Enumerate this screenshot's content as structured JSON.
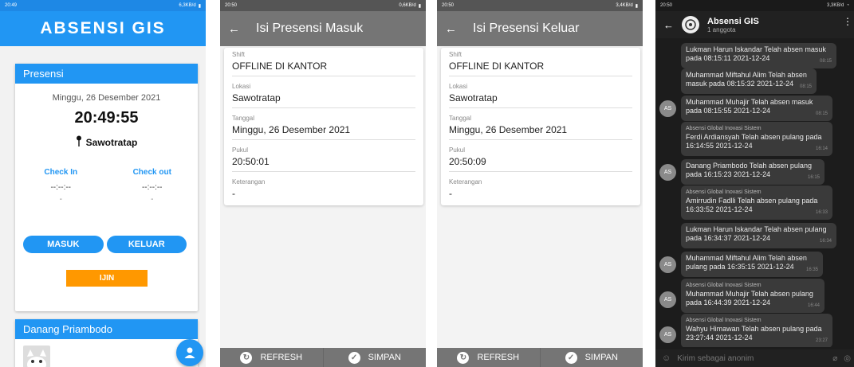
{
  "screen1": {
    "status_time": "20:49",
    "status_right": "6,3KB/d",
    "app_title": "ABSENSI GIS",
    "presensi_header": "Presensi",
    "date": "Minggu, 26 Desember 2021",
    "time": "20:49:55",
    "location": "Sawotratap",
    "checkin_label": "Check In",
    "checkin_time": "--:--:--",
    "checkin_sub": "-",
    "checkout_label": "Check out",
    "checkout_time": "--:--:--",
    "checkout_sub": "-",
    "masuk_label": "MASUK",
    "keluar_label": "KELUAR",
    "ijin_label": "IJIN",
    "user_header": "Danang Priambodo"
  },
  "screen2": {
    "status_time": "20:50",
    "status_right": "0,6KB/d",
    "title": "Isi Presensi Masuk",
    "fields": [
      {
        "label": "Shift",
        "value": "OFFLINE DI KANTOR"
      },
      {
        "label": "Lokasi",
        "value": "Sawotratap"
      },
      {
        "label": "Tanggal",
        "value": "Minggu, 26 Desember 2021"
      },
      {
        "label": "Pukul",
        "value": "20:50:01"
      },
      {
        "label": "Keterangan",
        "value": "-"
      }
    ],
    "refresh_label": "REFRESH",
    "simpan_label": "SIMPAN"
  },
  "screen3": {
    "status_time": "20:50",
    "status_right": "3,4KB/d",
    "title": "Isi Presensi Keluar",
    "fields": [
      {
        "label": "Shift",
        "value": "OFFLINE DI KANTOR"
      },
      {
        "label": "Lokasi",
        "value": "Sawotratap"
      },
      {
        "label": "Tanggal",
        "value": "Minggu, 26 Desember 2021"
      },
      {
        "label": "Pukul",
        "value": "20:50:09"
      },
      {
        "label": "Keterangan",
        "value": "-"
      }
    ],
    "refresh_label": "REFRESH",
    "simpan_label": "SIMPAN"
  },
  "screen4": {
    "status_time": "20:50",
    "status_right": "3,3KB/d",
    "group_name": "Absensi GIS",
    "members": "1 anggota",
    "avatar_initials": "AS",
    "messages": [
      {
        "sender": "",
        "text": "Lukman Harun Iskandar Telah absen masuk pada 08:15:11 2021-12-24",
        "ts": "08:15"
      },
      {
        "sender": "",
        "text": "Muhammad Miftahul Alim Telah absen masuk pada 08:15:32 2021-12-24",
        "ts": "08:15"
      },
      {
        "sender": "",
        "text": "Muhammad Muhajir Telah absen masuk pada 08:15:55 2021-12-24",
        "ts": "08:15"
      },
      {
        "sender": "Absensi Global Inovasi Sistem",
        "text": "Ferdi Ardiansyah Telah absen pulang pada 16:14:55 2021-12-24",
        "ts": "16:14"
      },
      {
        "sender": "",
        "text": "Danang  Priambodo Telah absen pulang pada 16:15:23 2021-12-24",
        "ts": "16:15"
      },
      {
        "sender": "Absensi Global Inovasi Sistem",
        "text": "Amirrudin Fadlli Telah absen pulang pada 16:33:52 2021-12-24",
        "ts": "16:33"
      },
      {
        "sender": "",
        "text": "Lukman Harun Iskandar Telah absen pulang pada 16:34:37 2021-12-24",
        "ts": "16:34"
      },
      {
        "sender": "",
        "text": "Muhammad Miftahul Alim Telah absen pulang pada 16:35:15 2021-12-24",
        "ts": "16:35"
      },
      {
        "sender": "Absensi Global Inovasi Sistem",
        "text": "Muhammad Muhajir Telah absen pulang pada 16:44:39 2021-12-24",
        "ts": "16:44"
      },
      {
        "sender": "Absensi Global Inovasi Sistem",
        "text": "Wahyu Himawan Telah absen pulang pada 23:27:44 2021-12-24",
        "ts": "23:27"
      }
    ],
    "input_placeholder": "Kirim sebagai anonim"
  }
}
